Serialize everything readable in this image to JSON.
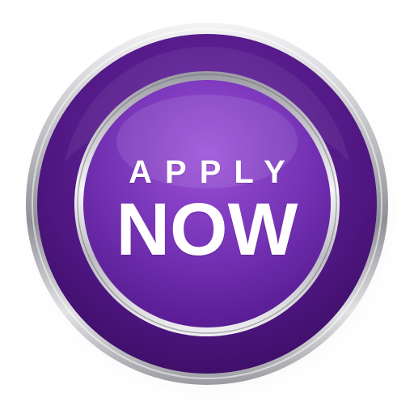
{
  "button": {
    "line1": "APPLY",
    "line2": "NOW"
  },
  "colors": {
    "outer_purple": "#5a1e8c",
    "inner_purple": "#7a33b8",
    "chrome": "#c8c8cc",
    "text": "#ffffff"
  }
}
